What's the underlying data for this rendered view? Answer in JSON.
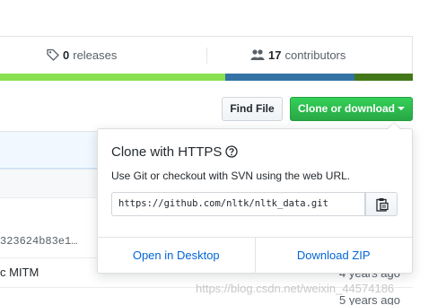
{
  "summary": {
    "releases_count": "0",
    "releases_label": "releases",
    "contributors_count": "17",
    "contributors_label": "contributors"
  },
  "language_bar": {
    "colors": [
      "#89e051",
      "#3572a5",
      "#427819"
    ]
  },
  "toolbar": {
    "find_file_label": "Find File",
    "clone_label": "Clone or download"
  },
  "background_rows": {
    "commit_sha": "323624b83e1…",
    "row_message": "c MITM",
    "times": [
      "4 years ago",
      "5 years ago"
    ]
  },
  "clone_popover": {
    "title": "Clone with HTTPS",
    "description": "Use Git or checkout with SVN using the web URL.",
    "url": "https://github.com/nltk/nltk_data.git",
    "open_desktop_label": "Open in Desktop",
    "download_zip_label": "Download ZIP"
  },
  "watermark": "https://blog.csdn.net/weixin_44574186",
  "colors": {
    "accent_green": "#28a745",
    "link_blue": "#0366d6"
  },
  "icons": [
    "tag-icon",
    "people-icon",
    "help-icon",
    "clipboard-icon",
    "caret-down-icon"
  ]
}
